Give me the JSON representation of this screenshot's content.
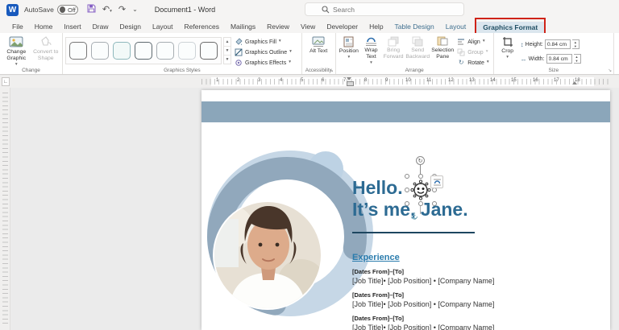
{
  "titlebar": {
    "autosave_label": "AutoSave",
    "autosave_state": "Off",
    "doc_title": "Document1 - Word",
    "search_placeholder": "Search"
  },
  "tabs": {
    "main": [
      "File",
      "Home",
      "Insert",
      "Draw",
      "Design",
      "Layout",
      "References",
      "Mailings",
      "Review",
      "View",
      "Developer",
      "Help"
    ],
    "contextual": [
      "Table Design",
      "Layout"
    ],
    "active": "Graphics Format"
  },
  "ribbon": {
    "change_graphic": "Change Graphic",
    "convert_to_shape": "Convert to Shape",
    "change_group": "Change",
    "graphics_fill": "Graphics Fill",
    "graphics_outline": "Graphics Outline",
    "graphics_effects": "Graphics Effects",
    "styles_group": "Graphics Styles",
    "alt_text": "Alt Text",
    "accessibility_group": "Accessibility",
    "position": "Position",
    "wrap_text": "Wrap Text",
    "bring_forward": "Bring Forward",
    "send_backward": "Send Backward",
    "selection_pane": "Selection Pane",
    "align": "Align",
    "group": "Group",
    "rotate": "Rotate",
    "arrange_group": "Arrange",
    "crop": "Crop",
    "height_label": "Height:",
    "height_value": "0.84 cm",
    "width_label": "Width:",
    "width_value": "0.84 cm",
    "size_group": "Size"
  },
  "ruler": {
    "numbers": [
      "1",
      "2",
      "3",
      "4",
      "5",
      "6",
      "7",
      "8",
      "9",
      "10",
      "11",
      "12",
      "13",
      "14",
      "15",
      "16",
      "17",
      "18"
    ]
  },
  "document": {
    "greeting_line1": "Hello.",
    "greeting_line2": "It’s me, Jane.",
    "experience_heading": "Experience",
    "entries": [
      {
        "dates": "[Dates From]–[To]",
        "role": "[Job Title]• [Job Position] • [Company Name]"
      },
      {
        "dates": "[Dates From]–[To]",
        "role": "[Job Title]• [Job Position] • [Company Name]"
      },
      {
        "dates": "[Dates From]–[To]",
        "role": "[Job Title]• [Job Position] • [Company Name]"
      }
    ]
  },
  "icons": {
    "undo": "↶",
    "redo": "↷",
    "qat_more": "⌄",
    "save": "🖫",
    "dropdown": "▾",
    "spinner_up": "▲",
    "spinner_down": "▼",
    "gallery_up": "▲",
    "gallery_down": "▼",
    "gallery_more": "▼",
    "launcher": "↘",
    "rotate_handle": "↻",
    "rotate_btn": "↻",
    "height": "↕",
    "width": "↔",
    "anchor": "⚓",
    "tab_selector": "∟"
  },
  "colors": {
    "word_blue": "#185abd",
    "band_blue": "#8ba6ba",
    "light_blue": "#c6d7e6",
    "heading_blue": "#2d6b93",
    "teal_heading": "#2b7cad",
    "annotation_red": "#cf2318",
    "active_tab_bg": "#dbe6ee"
  }
}
